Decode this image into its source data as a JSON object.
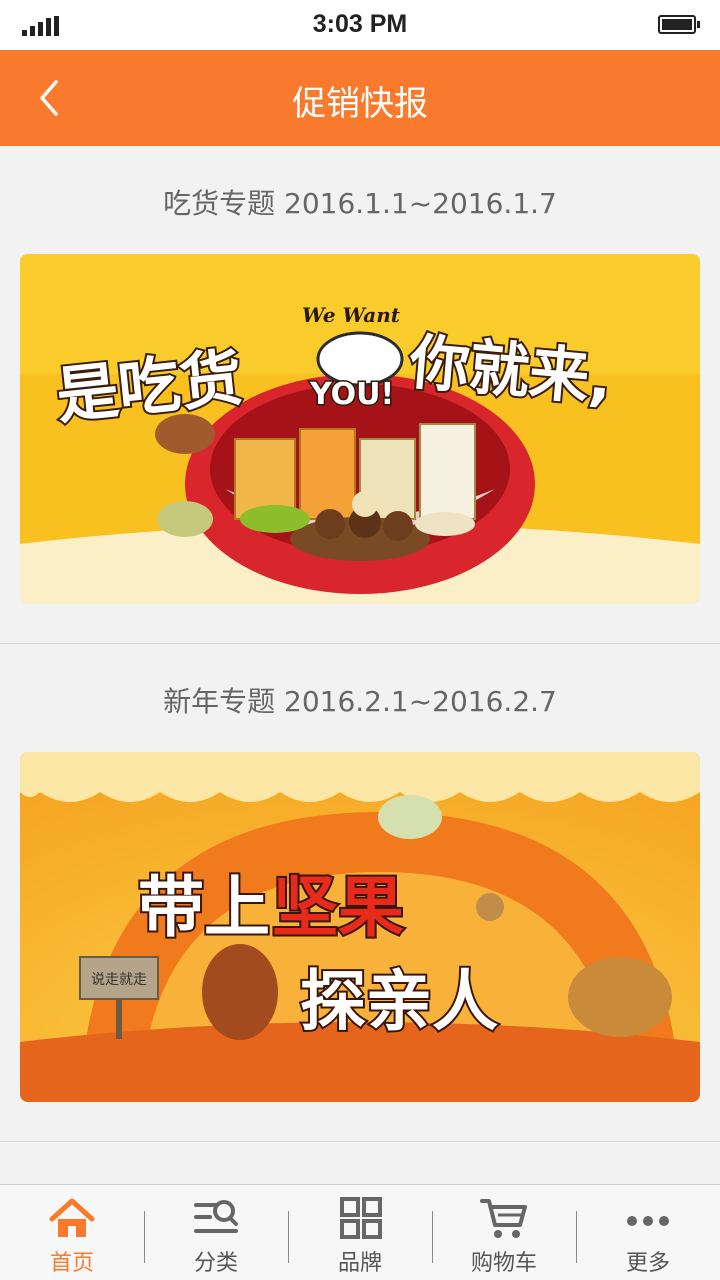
{
  "status_bar": {
    "time": "3:03 PM"
  },
  "header": {
    "title": "促销快报",
    "back_icon": "chevron-left-icon"
  },
  "promotions": [
    {
      "title": "吃货专题 2016.1.1~2016.1.7",
      "banner_text_main": "是吃货",
      "banner_text_tail": "你就来,",
      "banner_text_small": "We Want",
      "banner_text_you": "YOU!"
    },
    {
      "title": "新年专题 2016.2.1~2016.2.7",
      "banner_text_line1_a": "带上",
      "banner_text_line1_b": "坚果",
      "banner_text_line2": "探亲人",
      "banner_sign": "说走就走"
    }
  ],
  "tab_bar": {
    "items": [
      {
        "label": "首页",
        "icon": "home-icon",
        "active": true
      },
      {
        "label": "分类",
        "icon": "category-search-icon",
        "active": false
      },
      {
        "label": "品牌",
        "icon": "grid-icon",
        "active": false
      },
      {
        "label": "购物车",
        "icon": "cart-icon",
        "active": false
      },
      {
        "label": "更多",
        "icon": "more-icon",
        "active": false
      }
    ]
  },
  "colors": {
    "accent": "#f97a2d",
    "background": "#f2f2f2"
  }
}
